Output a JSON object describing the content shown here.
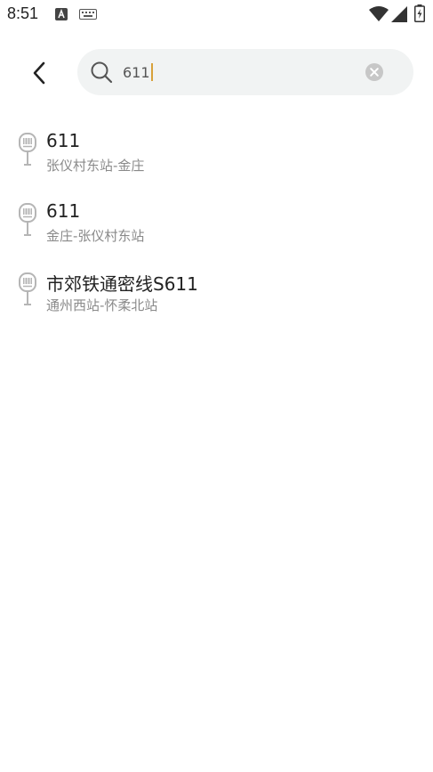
{
  "status_bar": {
    "time": "8:51",
    "icons": [
      "a-notification-icon",
      "keyboard-icon",
      "wifi-icon",
      "signal-icon",
      "battery-icon"
    ]
  },
  "search": {
    "value": "611",
    "placeholder": ""
  },
  "results": [
    {
      "title": "611",
      "subtitle": "张仪村东站-金庄",
      "icon": "bus-stop-icon"
    },
    {
      "title": "611",
      "subtitle": "金庄-张仪村东站",
      "icon": "bus-stop-icon"
    },
    {
      "title": "市郊铁通密线S611",
      "subtitle": "通州西站-怀柔北站",
      "icon": "bus-stop-icon"
    }
  ],
  "colors": {
    "accent_caret": "#d8a13a",
    "search_bg": "#f1f3f3",
    "subtitle": "#8a8a8a",
    "icon_gray": "#b5b5b5"
  }
}
